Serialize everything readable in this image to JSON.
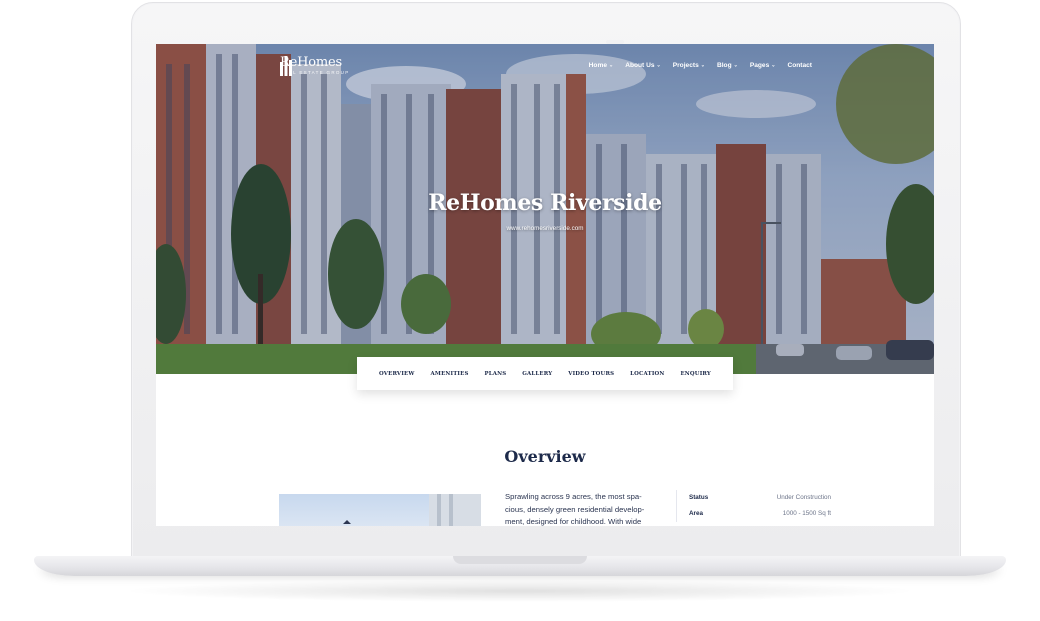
{
  "brand": {
    "name": "ReHomes",
    "tagline": "REAL ESTATE GROUP"
  },
  "nav": {
    "items": [
      {
        "label": "Home",
        "has_dropdown": true
      },
      {
        "label": "About Us",
        "has_dropdown": true
      },
      {
        "label": "Projects",
        "has_dropdown": true
      },
      {
        "label": "Blog",
        "has_dropdown": true
      },
      {
        "label": "Pages",
        "has_dropdown": true
      },
      {
        "label": "Contact",
        "has_dropdown": false
      }
    ]
  },
  "hero": {
    "title": "ReHomes Riverside",
    "url": "www.rehomesriverside.com"
  },
  "tabs": [
    "OVERVIEW",
    "AMENITIES",
    "PLANS",
    "GALLERY",
    "VIDEO TOURS",
    "LOCATION",
    "ENQUIRY"
  ],
  "overview": {
    "title": "Overview",
    "text": "Sprawling across 9 acres, the most spa- cious, densely green residential develop- ment, designed for childhood. With wide",
    "specs": [
      {
        "key": "Status",
        "value": "Under Construction"
      },
      {
        "key": "Area",
        "value": "1000 - 1500 Sq ft"
      }
    ]
  },
  "colors": {
    "navy": "#1d2a4a",
    "hero_sky": "#a8bcd8"
  }
}
